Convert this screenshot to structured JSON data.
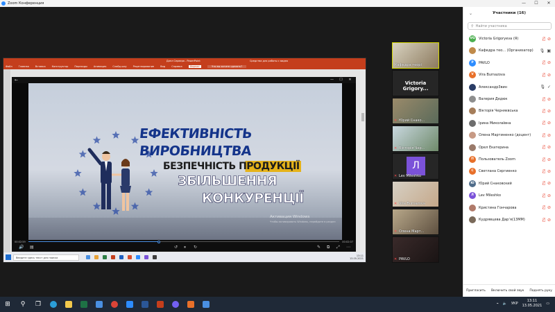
{
  "window": {
    "title": "Zoom Конференция"
  },
  "share": {
    "ppt_title": "Дипл Сервера - PowerPoint",
    "ppt_tab_context": "Средства для работы с видео",
    "ribbon_tabs": [
      "Файл",
      "Главная",
      "Вставка",
      "Конструктор",
      "Переходы",
      "Анимация",
      "Слайд-шоу",
      "Рецензирование",
      "Вид",
      "Справка",
      "Формат"
    ],
    "ribbon_active": "Формат",
    "search_hint": "Что вы хотите сделать?",
    "video": {
      "headline": [
        "ЕФЕКТИВНІСТЬ",
        "ВИРОБНИЦТВА",
        "БЕЗПЕЧНІСТЬ ПРОДУКЦІЇ",
        "ЗБІЛЬШЕННЯ",
        "КОНКУРЕНЦІЇ"
      ],
      "watermark_title": "Активация Windows",
      "watermark_sub": "Чтобы активировать Windows, перейдите в раздел",
      "time_current": "00:02:59",
      "time_total": "00:02:07",
      "progress_fraction": 0.42
    },
    "taskbar": {
      "search_placeholder": "Введите здесь текст для поиска",
      "time": "13:11",
      "date": "13.05.2021"
    }
  },
  "gallery": [
    {
      "name": "Кафедра теорі",
      "muted": false,
      "active": true,
      "type": "video"
    },
    {
      "name": "Victoria Grigory...",
      "muted": true,
      "type": "name"
    },
    {
      "name": "Юрий Снако...",
      "muted": true,
      "type": "video"
    },
    {
      "name": "Вікторія Чер...",
      "muted": true,
      "type": "video"
    },
    {
      "name": "Lev Mileshko",
      "muted": true,
      "type": "avatar",
      "letter": "Л"
    },
    {
      "name": "Vira Burnazova",
      "muted": true,
      "type": "video"
    },
    {
      "name": "Олена Март...",
      "muted": true,
      "type": "video"
    },
    {
      "name": "PAVLO",
      "muted": true,
      "type": "video"
    }
  ],
  "panel": {
    "title": "Участники (16)",
    "search_placeholder": "Найти участника",
    "participants": [
      {
        "name": "Victoria Grigoryeva (Я)",
        "initials": "VG",
        "color": "#4caf50",
        "muted": true,
        "cam": "off"
      },
      {
        "name": "Кафедра тео... (Организатор)",
        "initials": "",
        "color": "#c08a4a",
        "muted": false,
        "cam": "on"
      },
      {
        "name": "PAVLO",
        "initials": "P",
        "color": "#2d8cff",
        "muted": true,
        "cam": "off"
      },
      {
        "name": "Vira Burnazova",
        "initials": "V",
        "color": "#e8702a",
        "muted": true,
        "cam": "off"
      },
      {
        "name": "Александр3вин",
        "initials": "",
        "color": "#2a3d66",
        "muted": false,
        "cam": "check"
      },
      {
        "name": "Валерия Дедюк",
        "initials": "",
        "color": "#8e8e8e",
        "muted": true,
        "cam": "off"
      },
      {
        "name": "Вікторія Черняєвська",
        "initials": "",
        "color": "#a57d5a",
        "muted": true,
        "cam": "off"
      },
      {
        "name": "Ірина Миколаївна",
        "initials": "",
        "color": "#6d6d6d",
        "muted": true,
        "cam": "off"
      },
      {
        "name": "Олена Мартиненко (доцент)",
        "initials": "",
        "color": "#c79a85",
        "muted": true,
        "cam": "off"
      },
      {
        "name": "Орел Екатерина",
        "initials": "",
        "color": "#9a7a6a",
        "muted": true,
        "cam": "off"
      },
      {
        "name": "Пользователь Zoom",
        "initials": "П",
        "color": "#e8702a",
        "muted": true,
        "cam": "off"
      },
      {
        "name": "Светлана Сергиенко",
        "initials": "С",
        "color": "#e8702a",
        "muted": true,
        "cam": "off"
      },
      {
        "name": "Юрий Снаковский",
        "initials": "Ю",
        "color": "#4f6c8a",
        "muted": true,
        "cam": "off"
      },
      {
        "name": "Lev Mileshko",
        "initials": "Л",
        "color": "#7b52d9",
        "muted": true,
        "cam": "off"
      },
      {
        "name": "Кристина Гончарова",
        "initials": "",
        "color": "#b07a6a",
        "muted": true,
        "cam": "off"
      },
      {
        "name": "Кудрявцева Дарʼя(13ММ)",
        "initials": "",
        "color": "#7a6a5a",
        "muted": true,
        "cam": "off"
      }
    ],
    "footer": {
      "invite": "Пригласить",
      "unmute": "Включить свой звук",
      "raise_hand": "Поднять руку"
    }
  },
  "taskbar": {
    "language": "УКР",
    "time": "13:11",
    "date": "13.05.2021"
  }
}
